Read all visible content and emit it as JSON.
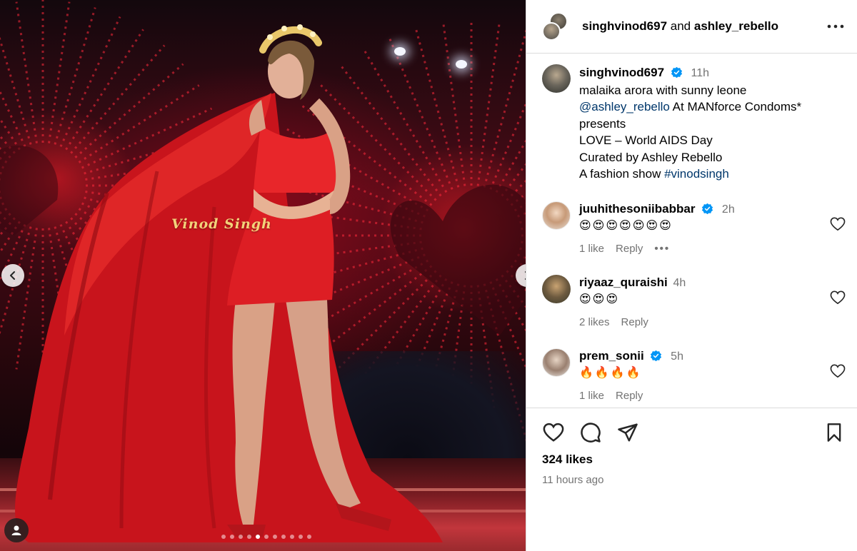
{
  "media": {
    "watermark": "Vinod Singh",
    "slide_count": 11,
    "active_slide": 4
  },
  "header": {
    "user1": "singhvinod697",
    "joiner": "and",
    "user2": "ashley_rebello"
  },
  "caption": {
    "username": "singhvinod697",
    "time": "11h",
    "line1": "malaika arora with sunny leone",
    "mention": "@ashley_rebello",
    "line2_rest": " At MANforce Condoms*",
    "line3": "presents",
    "line4": "LOVE – World AIDS Day",
    "line5": "Curated by Ashley Rebello",
    "line6_prefix": "A fashion show ",
    "hashtag": "#vinodsingh"
  },
  "comments": [
    {
      "username": "juuhithesoniibabbar",
      "verified": true,
      "time": "2h",
      "text": "😍😍😍😍😍😍😍",
      "likes": "1 like",
      "reply": "Reply",
      "more": "•••"
    },
    {
      "username": "riyaaz_quraishi",
      "verified": false,
      "time": "4h",
      "text": "😍😍😍",
      "likes": "2 likes",
      "reply": "Reply"
    },
    {
      "username": "prem_sonii",
      "verified": true,
      "time": "5h",
      "text": "🔥🔥🔥🔥",
      "likes": "1 like",
      "reply": "Reply"
    }
  ],
  "footer": {
    "likes": "324 likes",
    "time_ago": "11 hours ago"
  },
  "colors": {
    "verified": "#0095f6",
    "link": "#00376b",
    "muted": "#737373",
    "border": "#dbdbdb"
  }
}
